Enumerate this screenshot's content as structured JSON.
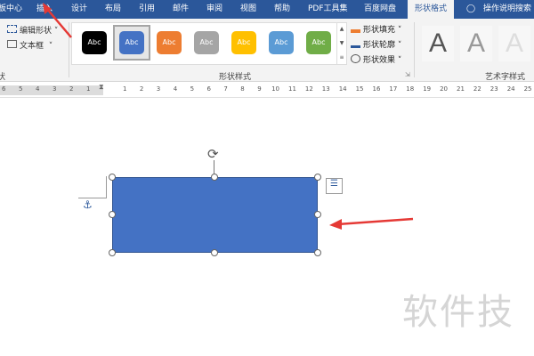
{
  "tabs": [
    {
      "label": "板中心"
    },
    {
      "label": "插入"
    },
    {
      "label": "设计"
    },
    {
      "label": "布局"
    },
    {
      "label": "引用"
    },
    {
      "label": "邮件"
    },
    {
      "label": "审阅"
    },
    {
      "label": "视图"
    },
    {
      "label": "帮助"
    },
    {
      "label": "PDF工具集"
    },
    {
      "label": "百度网盘"
    },
    {
      "label": "形状格式",
      "active": true
    },
    {
      "label": "操作说明搜索"
    }
  ],
  "insert_shapes": {
    "edit_shape": "编辑形状",
    "text_box": "文本框",
    "group_label_partial": "状"
  },
  "shape_styles": {
    "label": "形状样式",
    "swatch_text": "Abc",
    "swatches": [
      "#000000",
      "#4472c4",
      "#ed7d31",
      "#a5a5a5",
      "#ffc000",
      "#5b9bd5",
      "#70ad47"
    ],
    "fill": "形状填充",
    "outline": "形状轮廓",
    "effects": "形状效果"
  },
  "wordart": {
    "label": "艺术字样式",
    "letter": "A"
  },
  "ruler": {
    "left": [
      "6",
      "5",
      "4",
      "3",
      "2",
      "1"
    ],
    "right": [
      "1",
      "2",
      "3",
      "4",
      "5",
      "6",
      "7",
      "8",
      "9",
      "10",
      "11",
      "12",
      "13",
      "14",
      "15",
      "16",
      "17",
      "18",
      "19",
      "20",
      "21",
      "22",
      "23",
      "24",
      "25"
    ]
  },
  "shape": {
    "fill": "#4472c4"
  },
  "watermark": "软件技",
  "colors": {
    "accent": "#2b579a",
    "arrow": "#e53935"
  }
}
